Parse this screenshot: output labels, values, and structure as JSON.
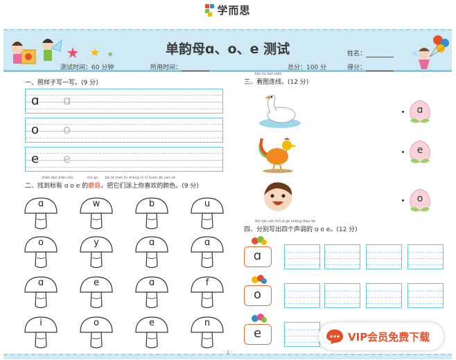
{
  "brand": {
    "name": "学而思"
  },
  "header": {
    "title": "单韵母ɑ、o、e 测试",
    "exam_time": "测试时间：60 分钟",
    "used_time_label": "所用时间：",
    "total_score": "总分：100 分",
    "name_label": "姓名：",
    "score_label": "得分："
  },
  "section1": {
    "title": "一、照样子写一写。(9 分)",
    "rows": [
      {
        "model": "ɑ",
        "trace": "ɑ"
      },
      {
        "model": "o",
        "trace": "o"
      },
      {
        "model": "e",
        "trace": "e"
      }
    ]
  },
  "section2": {
    "title_prefix": "二、找到标有 ɑ o e 的",
    "title_highlight": "蘑菇",
    "title_suffix": "，把它们涂上你喜欢的颜色。(9 分)",
    "pinyin": "zhǎo dào biāo yǒu　　　　mó gu　　bǎ tā men tú shàng nǐ xǐ huan de yán sè",
    "mushrooms": [
      "ɑ",
      "w",
      "b",
      "u",
      "o",
      "y",
      "ɑ",
      "ɑ",
      "ɑ",
      "e",
      "ɑ",
      "f",
      "i",
      "o",
      "e",
      "n"
    ]
  },
  "section3": {
    "title": "三、看图连线。(12 分)",
    "pinyin": "kàn tú lián xiàn",
    "peaches": [
      "ɑ",
      "e",
      "o"
    ],
    "pictures": [
      "goose-picture",
      "rooster-picture",
      "boy-face-picture"
    ]
  },
  "section4": {
    "title": "四、分别写出四个声调的 ɑ o e。(12 分)",
    "pinyin": "fēn bié xiě chū sì gè shēng diào de",
    "letters": [
      "ɑ",
      "o",
      "e"
    ]
  },
  "watermark": {
    "text": "VIP会员免费下载"
  },
  "footer": {
    "page": "· 1 ·"
  },
  "colors": {
    "accent": "#5fc4e6",
    "header_bg": "#cfe9f5",
    "card_border": "#e86b2e",
    "vip_red": "#e94f27"
  }
}
